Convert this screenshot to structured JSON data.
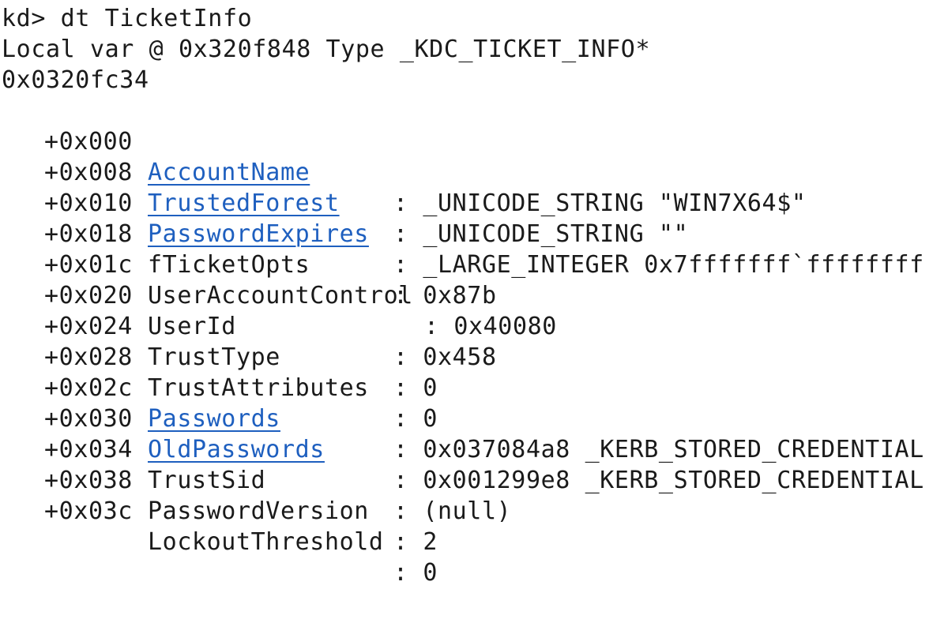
{
  "debugger": {
    "prompt": "kd>",
    "command": "dt TicketInfo",
    "local_var_line": "Local var @ 0x320f848 Type _KDC_TICKET_INFO*",
    "address": "0x0320fc34"
  },
  "fields": [
    {
      "offset": "+0x000",
      "name": "AccountName",
      "link": true,
      "value": ": _UNICODE_STRING \"WIN7X64$\""
    },
    {
      "offset": "+0x008",
      "name": "TrustedForest",
      "link": true,
      "value": ": _UNICODE_STRING \"\""
    },
    {
      "offset": "+0x010",
      "name": "PasswordExpires",
      "link": true,
      "value": ": _LARGE_INTEGER 0x7fffffff`ffffffff"
    },
    {
      "offset": "+0x018",
      "name": "fTicketOpts",
      "link": false,
      "value": ": 0x87b"
    },
    {
      "offset": "+0x01c",
      "name": "UserAccountControl",
      "link": false,
      "value": ": 0x40080"
    },
    {
      "offset": "+0x020",
      "name": "UserId",
      "link": false,
      "value": ": 0x458"
    },
    {
      "offset": "+0x024",
      "name": "TrustType",
      "link": false,
      "value": ": 0"
    },
    {
      "offset": "+0x028",
      "name": "TrustAttributes",
      "link": false,
      "value": ": 0"
    },
    {
      "offset": "+0x02c",
      "name": "Passwords",
      "link": true,
      "value": ": 0x037084a8 _KERB_STORED_CREDENTIAL"
    },
    {
      "offset": "+0x030",
      "name": "OldPasswords",
      "link": true,
      "value": ": 0x001299e8 _KERB_STORED_CREDENTIAL"
    },
    {
      "offset": "+0x034",
      "name": "TrustSid",
      "link": false,
      "value": ": (null)"
    },
    {
      "offset": "+0x038",
      "name": "PasswordVersion",
      "link": false,
      "value": ": 2"
    },
    {
      "offset": "+0x03c",
      "name": "LockoutThreshold",
      "link": false,
      "value": ": 0"
    }
  ],
  "colors": {
    "text": "#1a1a1a",
    "link": "#1e5fbf",
    "background": "#ffffff"
  }
}
